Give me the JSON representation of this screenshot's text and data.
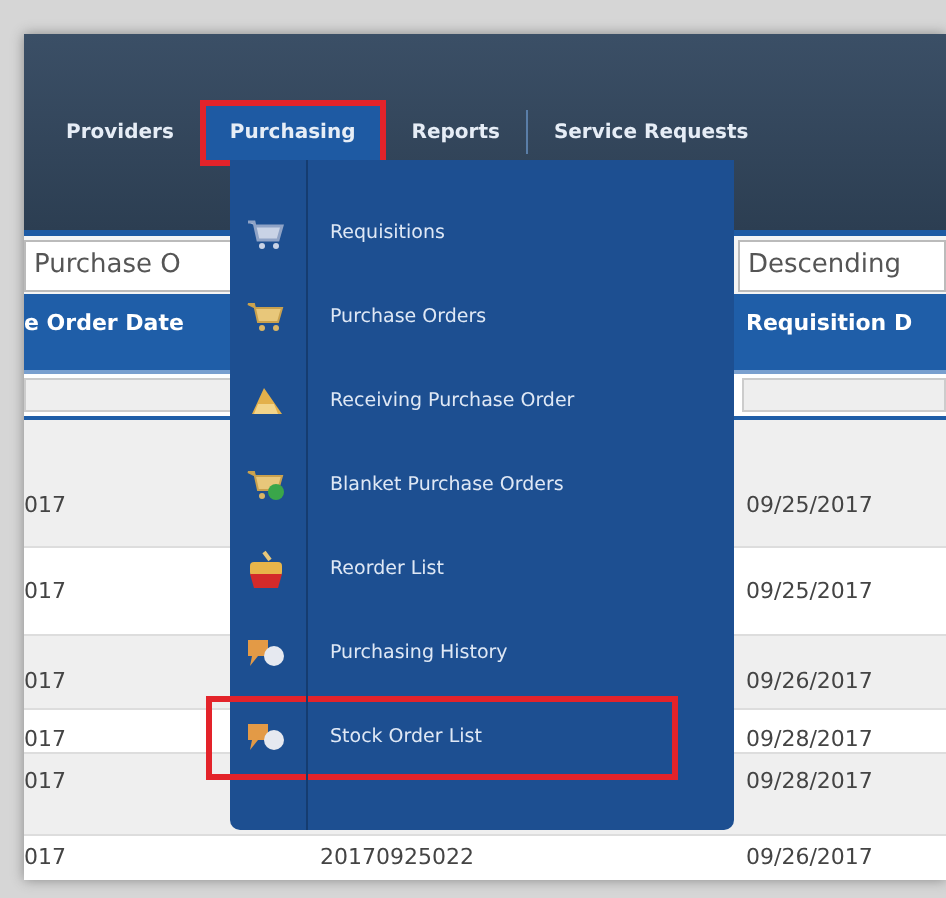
{
  "nav": [
    {
      "label": "Providers",
      "selected": false
    },
    {
      "label": "Purchasing",
      "selected": true
    },
    {
      "label": "Reports",
      "selected": false
    },
    {
      "label": "Service Requests",
      "selected": false
    }
  ],
  "menu": [
    {
      "label": "Requisitions",
      "highlighted": false
    },
    {
      "label": "Purchase Orders",
      "highlighted": false
    },
    {
      "label": "Receiving Purchase Order",
      "highlighted": false
    },
    {
      "label": "Blanket Purchase Orders",
      "highlighted": false
    },
    {
      "label": "Reorder List",
      "highlighted": false
    },
    {
      "label": "Purchasing History",
      "highlighted": false
    },
    {
      "label": "Stock Order List",
      "highlighted": true
    }
  ],
  "toolbar": {
    "sort_field": "Purchase O",
    "order_field": "Descending"
  },
  "table": {
    "columns": [
      "e Order Date",
      "Requisition D"
    ],
    "rows": [
      {
        "col_1": "017",
        "col_3": "09/25/2017"
      },
      {
        "col_1": "017",
        "col_3": "09/25/2017"
      },
      {
        "col_1": "017",
        "col_3": "09/26/2017"
      },
      {
        "col_1": "017",
        "col_3": "09/28/2017"
      },
      {
        "col_1": "017",
        "col_3": "09/28/2017"
      },
      {
        "col_1": "017",
        "col_2": "20170925022",
        "col_3": "09/26/2017"
      }
    ]
  }
}
